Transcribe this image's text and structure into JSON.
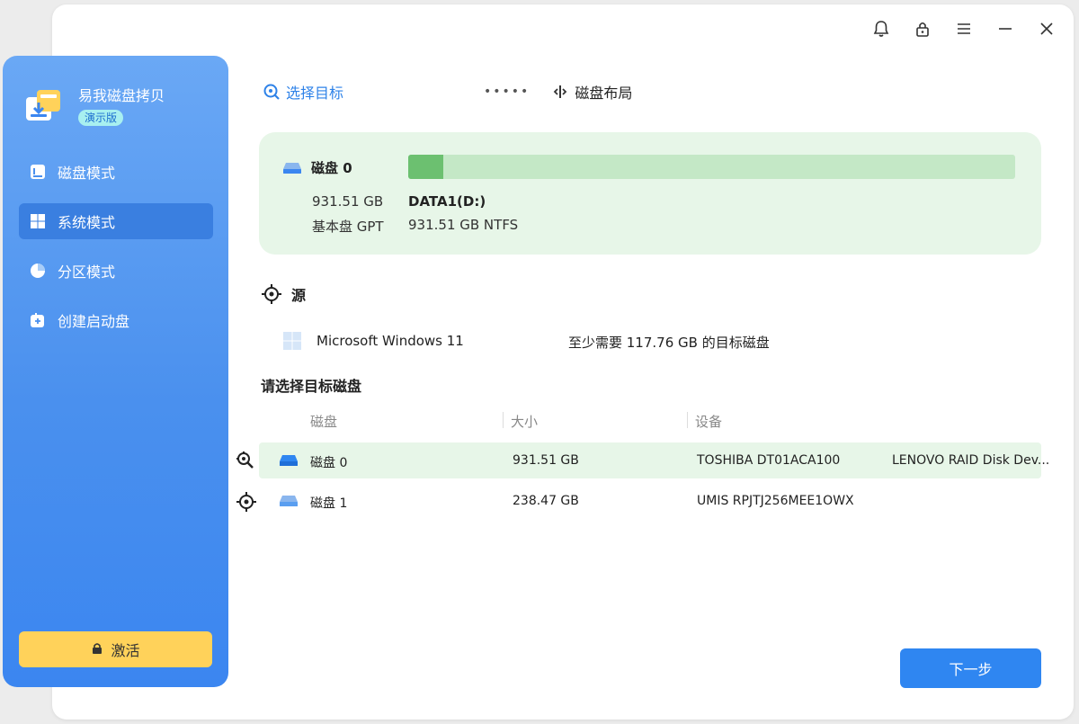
{
  "brand": {
    "name": "易我磁盘拷贝",
    "badge": "演示版"
  },
  "nav": [
    {
      "label": "磁盘模式"
    },
    {
      "label": "系统模式"
    },
    {
      "label": "分区模式"
    },
    {
      "label": "创建启动盘"
    }
  ],
  "activate": {
    "label": "激活"
  },
  "steps": {
    "step1": "选择目标",
    "dots": "•••••",
    "step2": "磁盘布局"
  },
  "disk_card": {
    "name": "磁盘 0",
    "size": "931.51 GB",
    "type": "基本盘 GPT",
    "partition_name": "DATA1(D:)",
    "partition_info": "931.51 GB NTFS",
    "usage_fraction": 0.058
  },
  "source": {
    "heading": "源",
    "os": "Microsoft Windows 11",
    "requirement": "至少需要 117.76 GB 的目标磁盘"
  },
  "target": {
    "heading": "请选择目标磁盘",
    "columns": [
      "磁盘",
      "大小",
      "设备"
    ],
    "rows": [
      {
        "name": "磁盘 0",
        "size": "931.51 GB",
        "device": "TOSHIBA DT01ACA100",
        "extra": "LENOVO RAID Disk Dev..."
      },
      {
        "name": "磁盘 1",
        "size": "238.47 GB",
        "device": "UMIS RPJTJ256MEE1OWX",
        "extra": ""
      }
    ]
  },
  "next": {
    "label": "下一步"
  },
  "colors": {
    "accent": "#2f86f1",
    "sidebar": "#4a90ee",
    "card": "#e7f6e8",
    "activate": "#ffd25a"
  }
}
